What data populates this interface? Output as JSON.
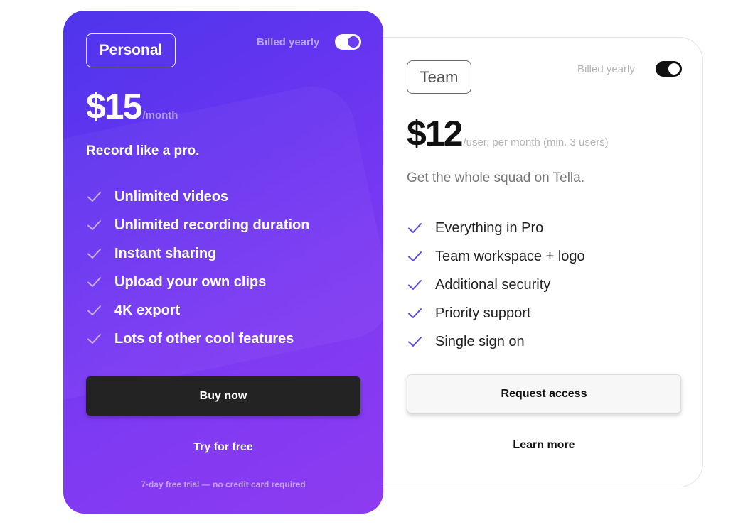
{
  "colors": {
    "personal_gradient_start": "#4d35ec",
    "personal_gradient_end": "#8d3bf0",
    "team_check": "#5a4bf0",
    "buy_button": "#232323"
  },
  "personal": {
    "tag": "Personal",
    "billed_label": "Billed yearly",
    "billed_yearly_on": true,
    "price": "$15",
    "price_unit": "/month",
    "tagline": "Record like a pro.",
    "features": [
      "Unlimited videos",
      "Unlimited recording duration",
      "Instant sharing",
      "Upload your own clips",
      "4K export",
      "Lots of other cool features"
    ],
    "check_icon": "check-icon",
    "buy_label": "Buy now",
    "try_label": "Try for free",
    "trial_note": "7-day free trial — no credit card required"
  },
  "team": {
    "tag": "Team",
    "billed_label": "Billed yearly",
    "billed_yearly_on": true,
    "price": "$12",
    "price_unit": "/user, per month (min. 3 users)",
    "tagline": "Get the whole squad on Tella.",
    "features": [
      "Everything in Pro",
      "Team workspace + logo",
      "Additional security",
      "Priority support",
      "Single sign on"
    ],
    "check_icon": "check-icon",
    "request_label": "Request access",
    "learn_label": "Learn more"
  }
}
